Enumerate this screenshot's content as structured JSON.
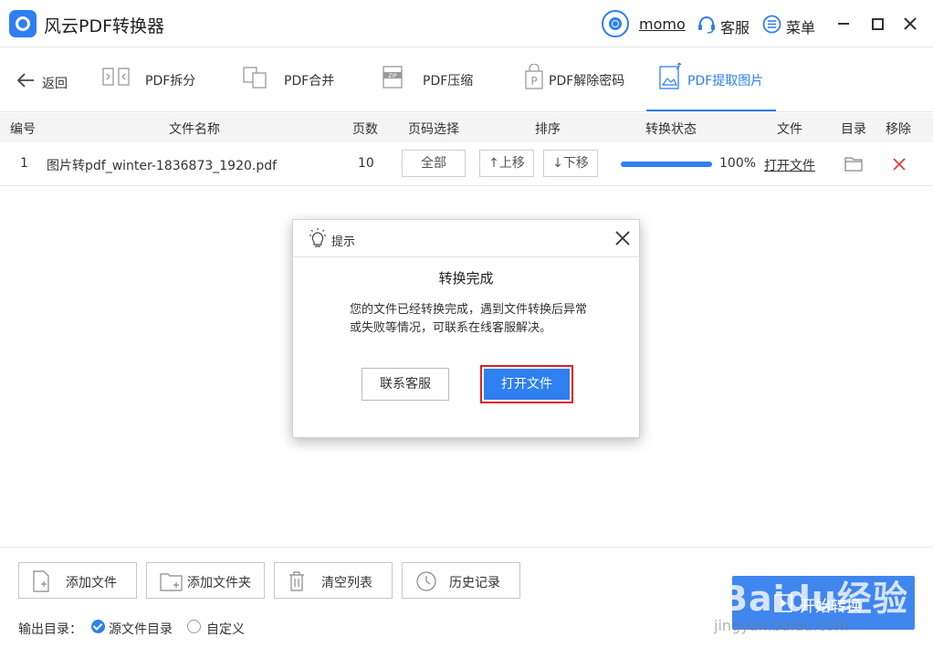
{
  "app": {
    "title": "风云PDF转换器",
    "user": "momo",
    "service_label": "客服",
    "menu_label": "菜单"
  },
  "toolbar": {
    "back_label": "返回",
    "tabs": [
      {
        "label": "PDF拆分"
      },
      {
        "label": "PDF合并"
      },
      {
        "label": "PDF压缩"
      },
      {
        "label": "PDF解除密码"
      },
      {
        "label": "PDF提取图片",
        "active": true
      }
    ]
  },
  "table": {
    "columns": [
      "编号",
      "文件名称",
      "页数",
      "页码选择",
      "排序",
      "转换状态",
      "文件",
      "目录",
      "移除"
    ],
    "rows": [
      {
        "index": "1",
        "filename": "图片转pdf_winter-1836873_1920.pdf",
        "pages": "10",
        "page_select": "全部",
        "move_up": "↑上移",
        "move_down": "↓下移",
        "progress": 1.0,
        "progress_text": "100%",
        "open_file": "打开文件"
      }
    ]
  },
  "dialog": {
    "title": "提示",
    "heading": "转换完成",
    "message": "您的文件已经转换完成，遇到文件转换后异常或失败等情况，可联系在线客服解决。",
    "contact_label": "联系客服",
    "open_label": "打开文件"
  },
  "bottom": {
    "add_file": "添加文件",
    "add_folder": "添加文件夹",
    "clear_list": "清空列表",
    "history": "历史记录",
    "output_label": "输出目录：",
    "option_source": "源文件目录",
    "option_custom": "自定义",
    "start_label": "开始转换"
  },
  "watermark": {
    "main": "Baidu经验",
    "sub": "jingyan.baidu.com"
  },
  "colors": {
    "accent": "#2e7ff0",
    "danger": "#e02020"
  }
}
